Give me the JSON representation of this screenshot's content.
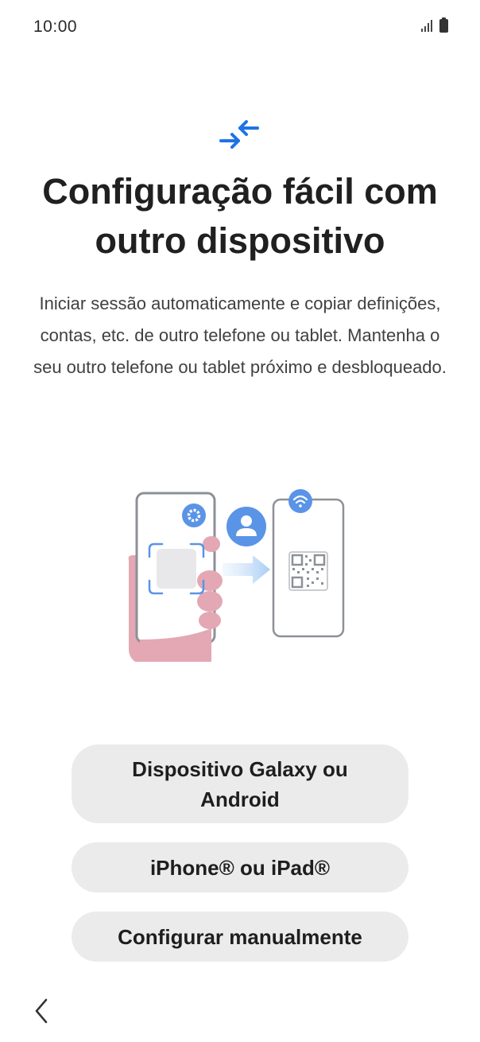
{
  "status_bar": {
    "time": "10:00",
    "icons": [
      "signal-icon",
      "battery-icon"
    ]
  },
  "header": {
    "icon": "transfer-arrows-icon",
    "title": "Configuração fácil com outro dispositivo",
    "description": "Iniciar sessão automaticamente e copiar definições, contas, etc. de outro telefone ou tablet. Mantenha o seu outro telefone ou tablet próximo e desbloqueado."
  },
  "illustration": {
    "name": "phone-to-phone-transfer-illustration",
    "icons": [
      "settings-icon",
      "account-icon",
      "wifi-icon",
      "qr-code-icon",
      "arrow-right-icon"
    ]
  },
  "options": [
    {
      "label": "Dispositivo Galaxy ou Android"
    },
    {
      "label": "iPhone® ou iPad®"
    },
    {
      "label": "Configurar manualmente"
    }
  ],
  "navigation": {
    "back_icon": "chevron-left-icon"
  },
  "colors": {
    "accent_blue": "#1f73e6",
    "button_bg": "#ebebec",
    "title_text": "#202020",
    "body_text": "#404040",
    "hand_pink": "#e3a8b4",
    "avatar_blue": "#5a94e6"
  }
}
